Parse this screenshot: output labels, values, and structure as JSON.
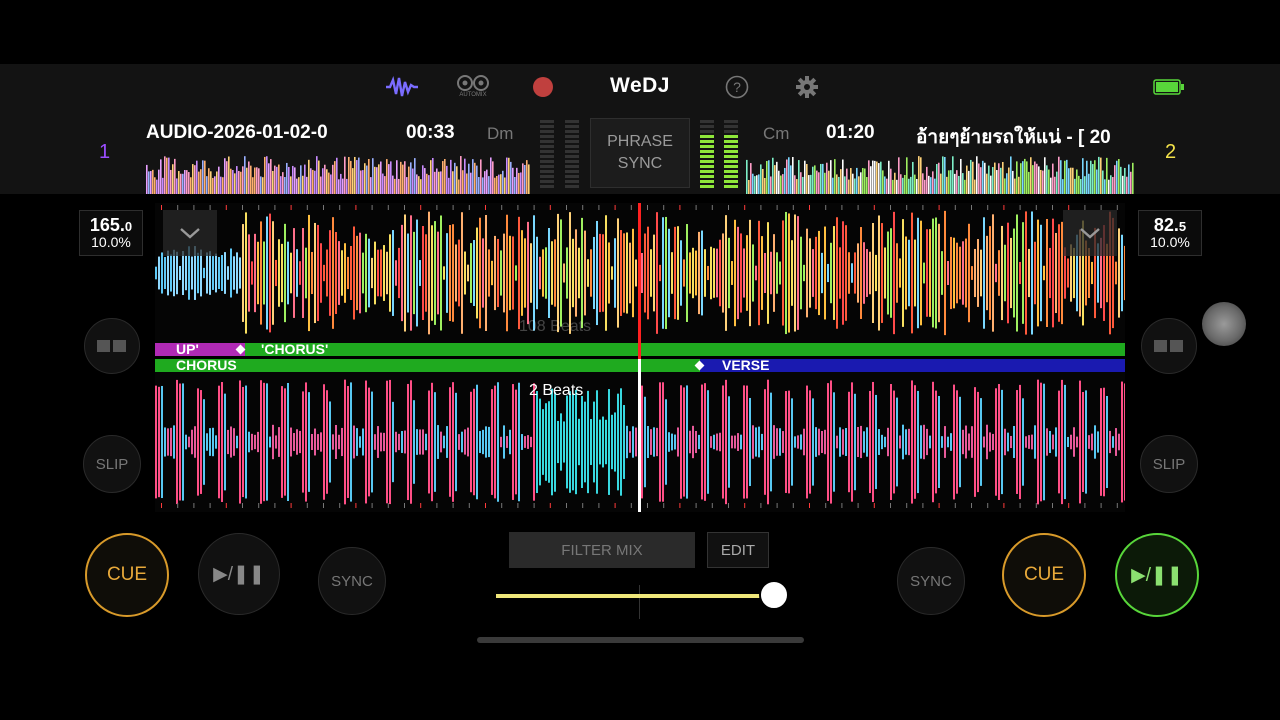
{
  "header": {
    "logo": "WeDJ",
    "automix_label": "AUTOMIX",
    "icons": [
      "waveform-icon",
      "automix-icon",
      "record-icon",
      "help-icon",
      "settings-icon",
      "battery-icon"
    ]
  },
  "deck1": {
    "number": "1",
    "title": "AUDIO-2026-01-02-0",
    "time": "00:33",
    "key": "Dm",
    "bpm_main": "165.",
    "bpm_decimal": "0",
    "pitch": "10.0%",
    "color": "#9b4dff"
  },
  "deck2": {
    "number": "2",
    "title": "อ้ายๆย้ายรถให้แน่ - [ 20",
    "time": "01:20",
    "key": "Cm",
    "bpm_main": "82.",
    "bpm_decimal": "5",
    "pitch": "10.0%",
    "color": "#f3e24a"
  },
  "phrase_sync": {
    "line1": "PHRASE",
    "line2": "SYNC"
  },
  "waveform": {
    "upper_overlay": "108 Beats",
    "lower_overlay": "2 Beats"
  },
  "phrases_upper": [
    {
      "label": "UP'",
      "color": "#b02ab5"
    },
    {
      "label": "'CHORUS'",
      "color": "#1faa1f"
    }
  ],
  "phrases_lower": [
    {
      "label": "CHORUS",
      "color": "#1faa1f"
    },
    {
      "label": "VERSE",
      "color": "#1a1ab0"
    }
  ],
  "controls": {
    "slip": "SLIP",
    "sync": "SYNC",
    "cue": "CUE",
    "play": "▶/❚❚",
    "filter_mix": "FILTER MIX",
    "edit": "EDIT"
  },
  "crossfader": {
    "position": 0.98
  },
  "colors": {
    "accent_cue": "#e8a93a",
    "play_active": "#58d63a",
    "playhead": "#ff2020"
  }
}
